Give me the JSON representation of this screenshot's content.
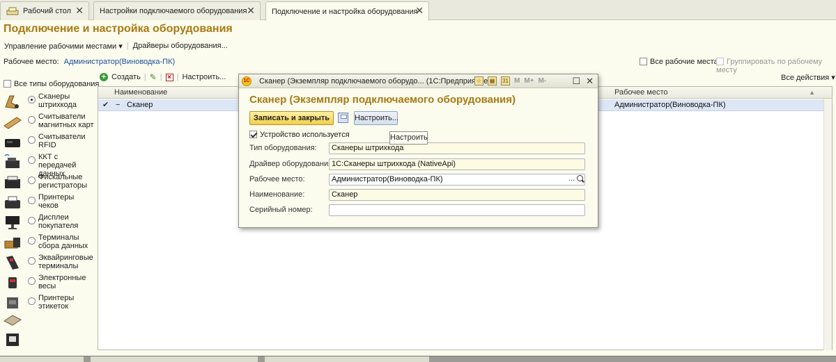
{
  "tabs": [
    {
      "label": "Рабочий стол"
    },
    {
      "label": "Настройки подключаемого оборудования"
    },
    {
      "label": "Подключение и настройка оборудования"
    }
  ],
  "page": {
    "title": "Подключение и настройка оборудования",
    "commands": [
      "Управление рабочими местами ▾",
      "Драйверы оборудования..."
    ],
    "workplace_label": "Рабочее место:",
    "workplace_value": "Администратор(Виноводка-ПК)",
    "all_workplaces": "Все рабочие места",
    "group_by_workplace": "Группировать по рабочему месту",
    "all_actions": "Все действия ▾"
  },
  "equipment": {
    "all_types": "Все типы оборудования",
    "items": [
      {
        "label": "Сканеры штрихкода",
        "selected": true,
        "icon": "barcode-scanner-icon"
      },
      {
        "label": "Считыватели магнитных карт",
        "selected": false,
        "icon": "card-reader-icon"
      },
      {
        "label": "Считыватели RFID",
        "selected": false,
        "icon": "rfid-reader-icon"
      },
      {
        "label": "ККТ с передачей данных",
        "selected": false,
        "icon": "cash-register-icon"
      },
      {
        "label": "Фискальные регистраторы",
        "selected": false,
        "icon": "fiscal-printer-icon"
      },
      {
        "label": "Принтеры чеков",
        "selected": false,
        "icon": "receipt-printer-icon"
      },
      {
        "label": "Дисплеи покупателя",
        "selected": false,
        "icon": "customer-display-icon"
      },
      {
        "label": "Терминалы сбора данных",
        "selected": false,
        "icon": "data-terminal-icon"
      },
      {
        "label": "Эквайринговые терминалы",
        "selected": false,
        "icon": "payment-terminal-icon"
      },
      {
        "label": "Электронные весы",
        "selected": false,
        "icon": "scale-icon"
      },
      {
        "label": "Принтеры этикеток",
        "selected": false,
        "icon": "label-printer-icon"
      }
    ]
  },
  "toolbar": {
    "create": "Создать",
    "configure": "Настроить..."
  },
  "table": {
    "columns": [
      "Наименование",
      "Рабочее место"
    ],
    "rows": [
      {
        "name": "Сканер",
        "workplace": "Администратор(Виноводка-ПК)"
      }
    ]
  },
  "modal": {
    "window_title": "Сканер (Экземпляр подключаемого оборудо...  (1С:Предприятие)",
    "heading": "Сканер (Экземпляр подключаемого оборудования)",
    "save_close": "Записать и закрыть",
    "configure": "Настроить...",
    "tooltip": "Настроить",
    "device_used": "Устройство используется",
    "tb_m": "M",
    "tb_mplus": "M+",
    "tb_mminus": "M-",
    "fields": [
      {
        "label": "Тип оборудования:",
        "value": "Сканеры штрихкода"
      },
      {
        "label": "Драйвер оборудования:",
        "value": "1С:Сканеры штрихкода (NativeApi)"
      },
      {
        "label": "Рабочее место:",
        "value": "Администратор(Виноводка-ПК)"
      },
      {
        "label": "Наименование:",
        "value": "Сканер"
      },
      {
        "label": "Серийный номер:",
        "value": ""
      }
    ]
  }
}
